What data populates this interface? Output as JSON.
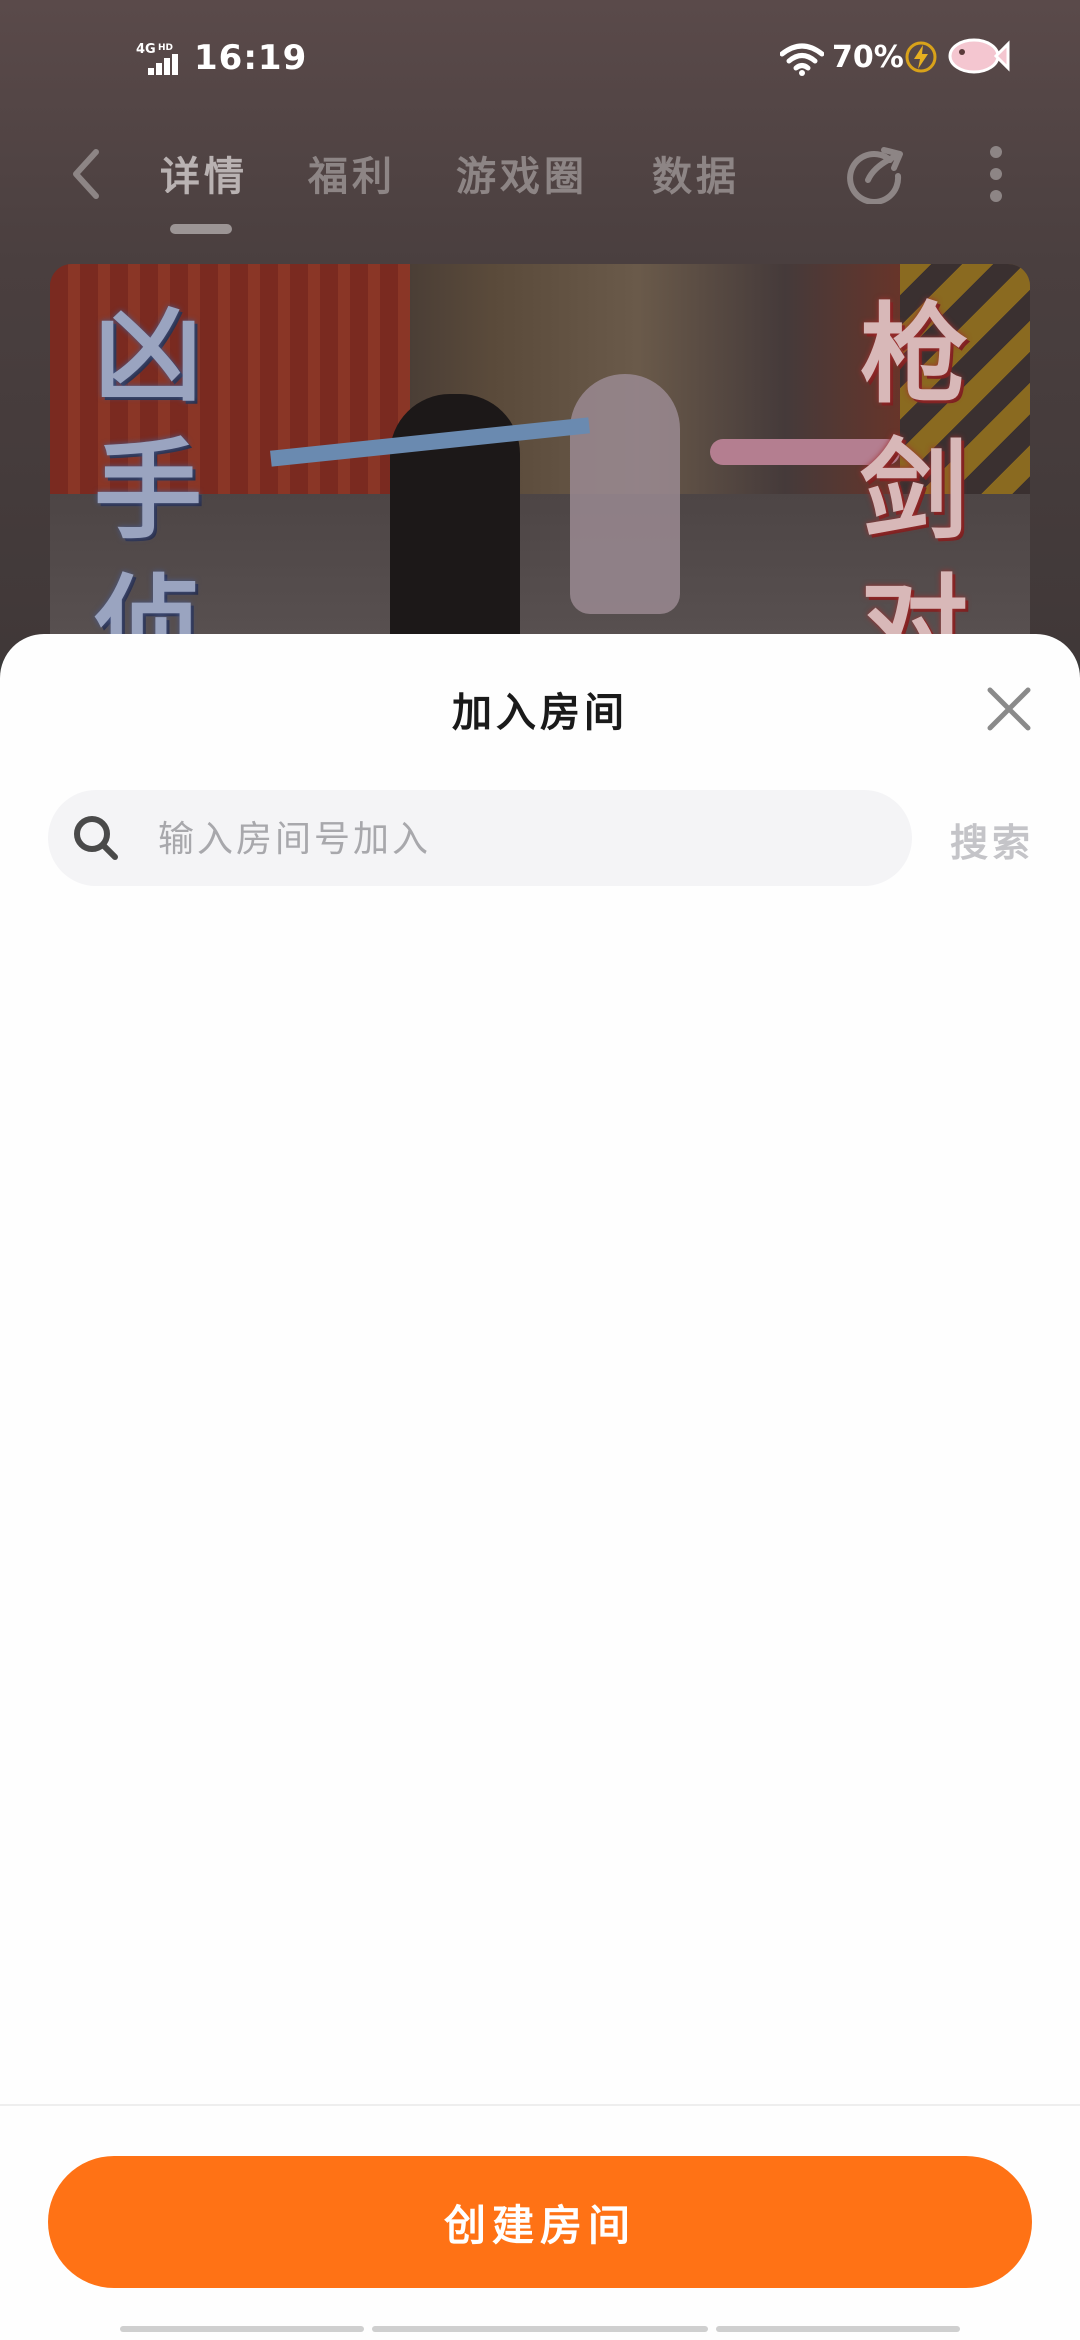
{
  "status_bar": {
    "network": "4G HD",
    "time": "16:19",
    "battery": "70%"
  },
  "nav": {
    "tabs": [
      {
        "label": "详情",
        "active": true
      },
      {
        "label": "福利",
        "active": false
      },
      {
        "label": "游戏圈",
        "active": false
      },
      {
        "label": "数据",
        "active": false
      }
    ]
  },
  "banner": {
    "left_text": [
      "凶",
      "手",
      "侦"
    ],
    "right_text": [
      "枪",
      "剑",
      "对"
    ]
  },
  "sheet": {
    "title": "加入房间",
    "search": {
      "placeholder": "输入房间号加入",
      "value": "",
      "button_label": "搜索"
    },
    "create_button_label": "创建房间"
  },
  "colors": {
    "accent": "#ff7215",
    "sheet_bg": "#fefefe",
    "search_bg": "#f4f4f6"
  },
  "icons": [
    "signal-icon",
    "wifi-icon",
    "charging-icon",
    "fish-avatar-icon",
    "back-icon",
    "share-icon",
    "more-icon",
    "close-icon",
    "search-icon"
  ]
}
